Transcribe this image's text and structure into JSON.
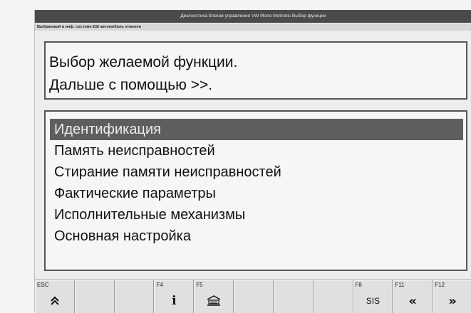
{
  "window": {
    "title": "Диагностика блоков управления  VW  Mono Motronic  Выбор функции",
    "status": "Выбранный в инф. системе ESI автомобиль отменен"
  },
  "prompt": {
    "line1": "Выбор желаемой функции.",
    "line2": "Дальше с помощью >>."
  },
  "menu": {
    "items": [
      {
        "label": "Идентификация",
        "selected": true
      },
      {
        "label": "Память неисправностей",
        "selected": false
      },
      {
        "label": "Стирание памяти неисправностей",
        "selected": false
      },
      {
        "label": "Фактические параметры",
        "selected": false
      },
      {
        "label": "Исполнительные механизмы",
        "selected": false
      },
      {
        "label": "Основная настройка",
        "selected": false
      }
    ]
  },
  "function_keys": [
    {
      "key": "ESC",
      "icon": "up-double-chevron-icon",
      "glyph": "︽"
    },
    {
      "key": "",
      "icon": "",
      "glyph": ""
    },
    {
      "key": "",
      "icon": "",
      "glyph": ""
    },
    {
      "key": "F4",
      "icon": "info-icon",
      "glyph": "i"
    },
    {
      "key": "F5",
      "icon": "car-workshop-icon",
      "glyph": ""
    },
    {
      "key": "",
      "icon": "",
      "glyph": ""
    },
    {
      "key": "",
      "icon": "",
      "glyph": ""
    },
    {
      "key": "",
      "icon": "",
      "glyph": ""
    },
    {
      "key": "F8",
      "icon": "sis-icon",
      "glyph": "SIS"
    },
    {
      "key": "F11",
      "icon": "back-icon",
      "glyph": "«"
    },
    {
      "key": "F12",
      "icon": "forward-icon",
      "glyph": "»"
    }
  ]
}
